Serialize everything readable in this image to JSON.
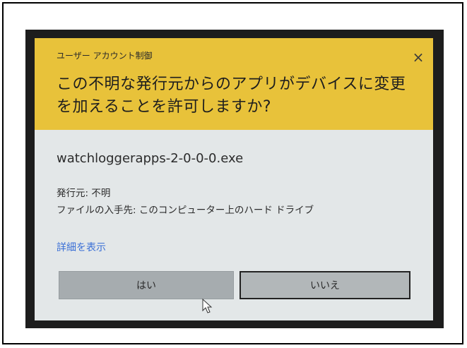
{
  "dialog": {
    "window_title": "ユーザー アカウント制御",
    "close_symbol": "×",
    "question": "この不明な発行元からのアプリがデバイスに変更を加えることを許可しますか?",
    "file_name": "watchloggerapps-2-0-0-0.exe",
    "publisher_line": "発行元: 不明",
    "origin_line": "ファイルの入手先: このコンピューター上のハード ドライブ",
    "details_link": "詳細を表示",
    "yes_label": "はい",
    "no_label": "いいえ"
  },
  "colors": {
    "header_accent": "#e8c23a",
    "dialog_background": "#e3e7e8",
    "link": "#3a6fd6"
  },
  "icons": {
    "close": "close-icon",
    "cursor": "mouse-pointer-icon"
  }
}
